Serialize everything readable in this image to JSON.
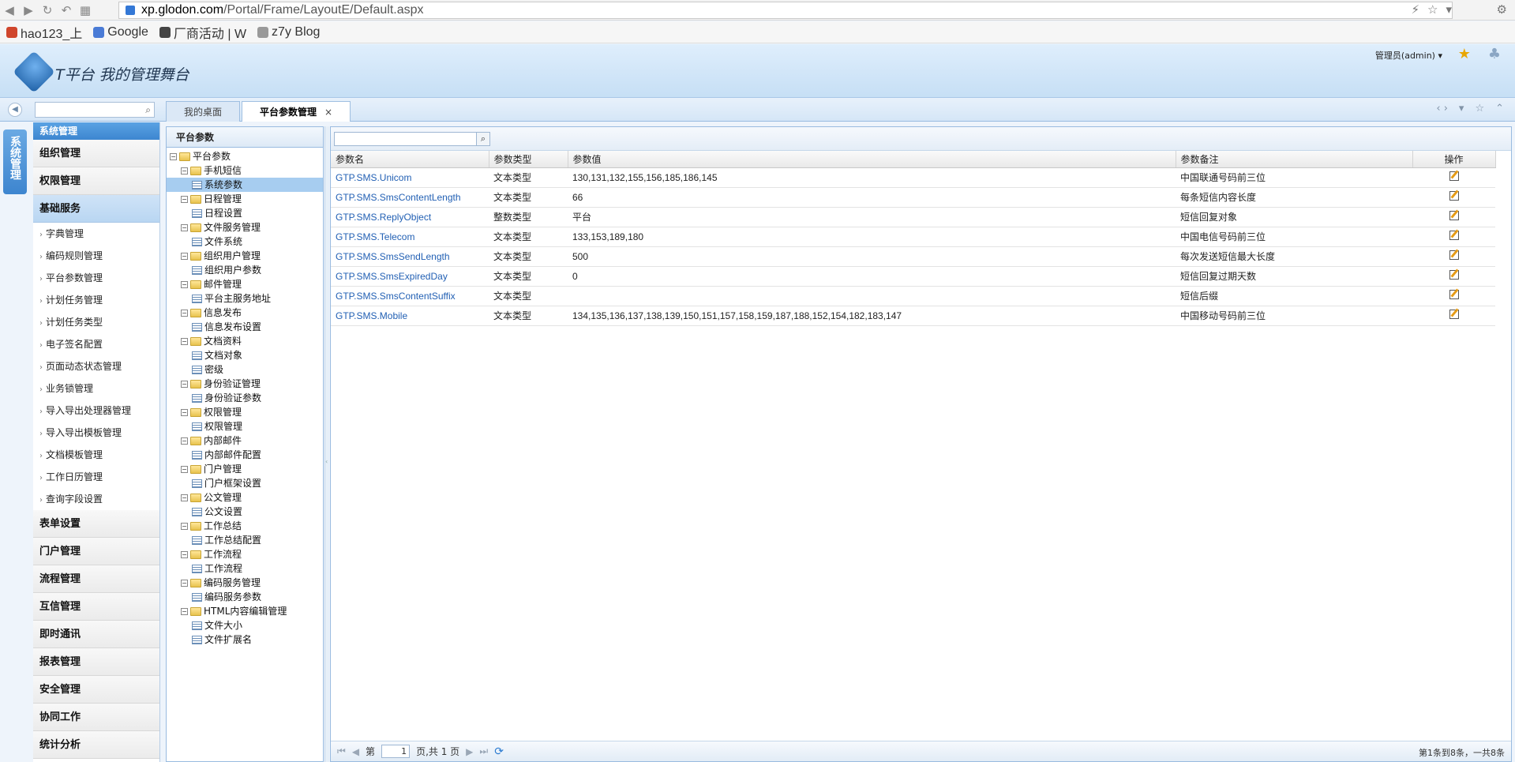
{
  "browser": {
    "url_host": "xp.glodon.com",
    "url_path": "/Portal/Frame/LayoutE/Default.aspx",
    "bookmarks": [
      {
        "label": "hao123_上",
        "color": "#d0462c"
      },
      {
        "label": "Google",
        "color": "#4a7bd6"
      },
      {
        "label": "厂商活动 | W",
        "color": "#444444"
      },
      {
        "label": "z7y Blog",
        "color": "#999999"
      }
    ]
  },
  "header": {
    "title": "T平台  我的管理舞台",
    "user": "管理员(admin) ▾"
  },
  "tabs": [
    {
      "label": "我的桌面"
    },
    {
      "label": "平台参数管理",
      "close": "×"
    }
  ],
  "left_vertical_tab": "系统管理",
  "menu": {
    "head": "系统管理",
    "groups_top": [
      "组织管理",
      "权限管理"
    ],
    "expanded_group": "基础服务",
    "subitems": [
      "字典管理",
      "编码规则管理",
      "平台参数管理",
      "计划任务管理",
      "计划任务类型",
      "电子签名配置",
      "页面动态状态管理",
      "业务锁管理",
      "导入导出处理器管理",
      "导入导出模板管理",
      "文档模板管理",
      "工作日历管理",
      "查询字段设置"
    ],
    "groups_bottom": [
      "表单设置",
      "门户管理",
      "流程管理",
      "互信管理",
      "即时通讯",
      "报表管理",
      "安全管理",
      "协同工作",
      "统计分析"
    ]
  },
  "tree": {
    "title": "平台参数",
    "root": "平台参数",
    "nodes": [
      {
        "label": "手机短信",
        "children": [
          "系统参数"
        ]
      },
      {
        "label": "日程管理",
        "children": [
          "日程设置"
        ]
      },
      {
        "label": "文件服务管理",
        "children": [
          "文件系统"
        ]
      },
      {
        "label": "组织用户管理",
        "children": [
          "组织用户参数"
        ]
      },
      {
        "label": "邮件管理",
        "children": [
          "平台主服务地址"
        ]
      },
      {
        "label": "信息发布",
        "children": [
          "信息发布设置"
        ]
      },
      {
        "label": "文档资料",
        "children": [
          "文档对象",
          "密级"
        ]
      },
      {
        "label": "身份验证管理",
        "children": [
          "身份验证参数"
        ]
      },
      {
        "label": "权限管理",
        "children": [
          "权限管理"
        ]
      },
      {
        "label": "内部邮件",
        "children": [
          "内部邮件配置"
        ]
      },
      {
        "label": "门户管理",
        "children": [
          "门户框架设置"
        ]
      },
      {
        "label": "公文管理",
        "children": [
          "公文设置"
        ]
      },
      {
        "label": "工作总结",
        "children": [
          "工作总结配置"
        ]
      },
      {
        "label": "工作流程",
        "children": [
          "工作流程"
        ]
      },
      {
        "label": "编码服务管理",
        "children": [
          "编码服务参数"
        ]
      },
      {
        "label": "HTML内容编辑管理",
        "children": [
          "文件大小",
          "文件扩展名"
        ]
      }
    ],
    "selected": "系统参数"
  },
  "grid": {
    "columns": [
      "参数名",
      "参数类型",
      "参数值",
      "参数备注",
      "操作"
    ],
    "rows": [
      {
        "name": "GTP.SMS.Unicom",
        "type": "文本类型",
        "value": "130,131,132,155,156,185,186,145",
        "note": "中国联通号码前三位"
      },
      {
        "name": "GTP.SMS.SmsContentLength",
        "type": "文本类型",
        "value": "66",
        "note": "每条短信内容长度"
      },
      {
        "name": "GTP.SMS.ReplyObject",
        "type": "整数类型",
        "value": "平台",
        "note": "短信回复对象"
      },
      {
        "name": "GTP.SMS.Telecom",
        "type": "文本类型",
        "value": "133,153,189,180",
        "note": "中国电信号码前三位"
      },
      {
        "name": "GTP.SMS.SmsSendLength",
        "type": "文本类型",
        "value": "500",
        "note": "每次发送短信最大长度"
      },
      {
        "name": "GTP.SMS.SmsExpiredDay",
        "type": "文本类型",
        "value": "0",
        "note": "短信回复过期天数"
      },
      {
        "name": "GTP.SMS.SmsContentSuffix",
        "type": "文本类型",
        "value": "",
        "note": "短信后缀"
      },
      {
        "name": "GTP.SMS.Mobile",
        "type": "文本类型",
        "value": "134,135,136,137,138,139,150,151,157,158,159,187,188,152,154,182,183,147",
        "note": "中国移动号码前三位"
      }
    ]
  },
  "pager": {
    "page_prefix": "第",
    "page_value": "1",
    "page_suffix": "页,共 1 页",
    "info": "第1条到8条，一共8条"
  }
}
